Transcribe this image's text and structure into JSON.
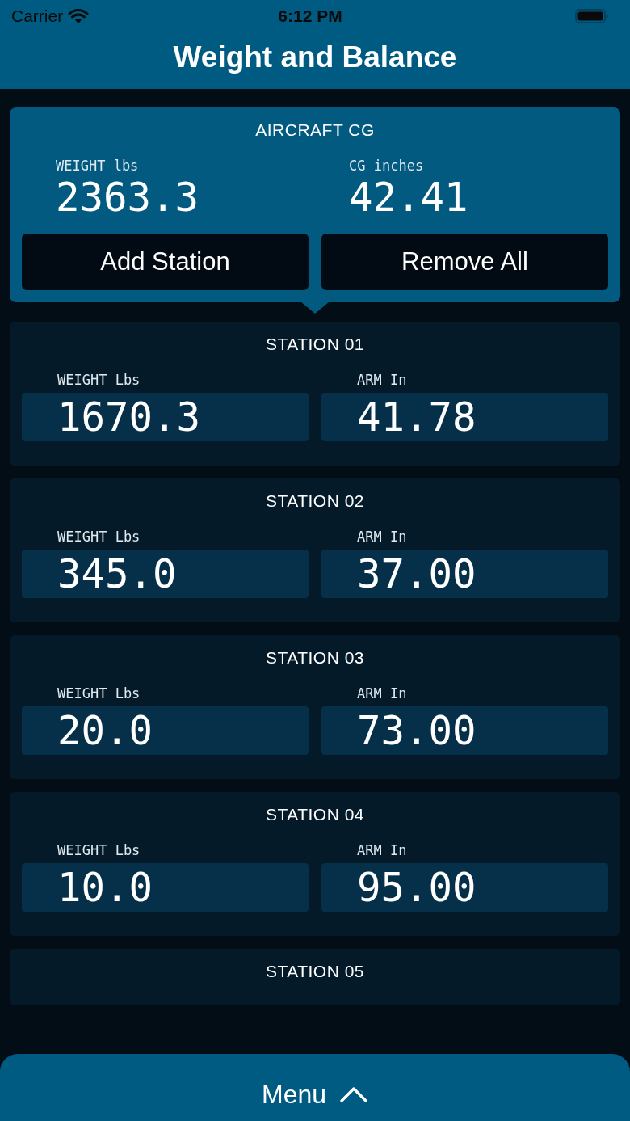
{
  "status_bar": {
    "carrier": "Carrier",
    "time": "6:12 PM"
  },
  "nav": {
    "title": "Weight and Balance"
  },
  "summary": {
    "title": "AIRCRAFT CG",
    "weight_label": "WEIGHT lbs",
    "weight": "2363.3",
    "cg_label": "CG inches",
    "cg": "42.41",
    "buttons": [
      "Add Station",
      "Remove All"
    ]
  },
  "stations": [
    {
      "title": "STATION 01",
      "weight_label": "WEIGHT Lbs",
      "weight": "1670.3",
      "arm_label": "ARM In",
      "arm": "41.78"
    },
    {
      "title": "STATION 02",
      "weight_label": "WEIGHT Lbs",
      "weight": "345.0",
      "arm_label": "ARM In",
      "arm": "37.00"
    },
    {
      "title": "STATION 03",
      "weight_label": "WEIGHT Lbs",
      "weight": "20.0",
      "arm_label": "ARM In",
      "arm": "73.00"
    },
    {
      "title": "STATION 04",
      "weight_label": "WEIGHT Lbs",
      "weight": "10.0",
      "arm_label": "ARM In",
      "arm": "95.00"
    },
    {
      "title": "STATION 05"
    }
  ],
  "menu": {
    "label": "Menu"
  }
}
